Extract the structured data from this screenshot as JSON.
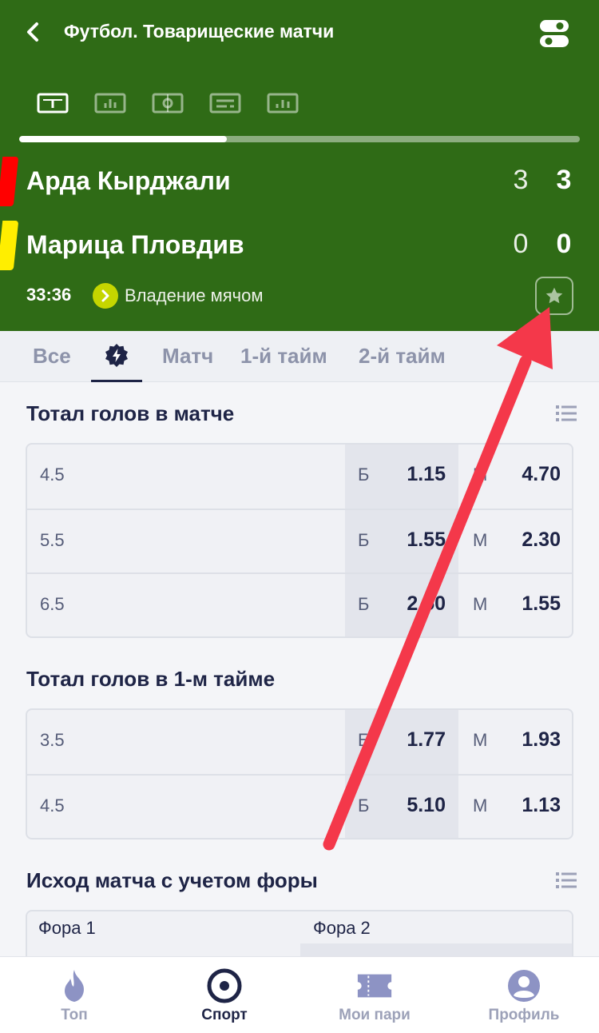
{
  "header": {
    "title": "Футбол. Товарищеские матчи",
    "back_icon": "chevron-left-icon",
    "toggle_icon": "toggle-icon",
    "icon_tabs": [
      "scoreboard-icon",
      "stats-icon",
      "field-icon",
      "lineup-icon",
      "chart-icon"
    ],
    "progress": 0.37,
    "colors": {
      "background": "#2f6b16",
      "card_red": "#ff0000",
      "card_yellow": "#ffee00"
    }
  },
  "match": {
    "team1": {
      "name": "Арда Кырджали",
      "score1": "3",
      "score2": "3"
    },
    "team2": {
      "name": "Марица Пловдив",
      "score1": "0",
      "score2": "0"
    },
    "time": "33:36",
    "status": "Владение мячом"
  },
  "filter_tabs": {
    "all": "Все",
    "match": "Матч",
    "half1": "1-й тайм",
    "half2": "2-й тайм"
  },
  "sections": {
    "total_match": {
      "title": "Тотал голов в матче",
      "rows": [
        {
          "line": "4.5",
          "tag_b": "Б",
          "odd_b": "1.15",
          "tag_m": "М",
          "odd_m": "4.70"
        },
        {
          "line": "5.5",
          "tag_b": "Б",
          "odd_b": "1.55",
          "tag_m": "М",
          "odd_m": "2.30"
        },
        {
          "line": "6.5",
          "tag_b": "Б",
          "odd_b": "2.50",
          "tag_m": "М",
          "odd_m": "1.55"
        }
      ]
    },
    "total_half1": {
      "title": "Тотал голов в 1-м тайме",
      "rows": [
        {
          "line": "3.5",
          "tag_b": "Б",
          "odd_b": "1.77",
          "tag_m": "М",
          "odd_m": "1.93"
        },
        {
          "line": "4.5",
          "tag_b": "Б",
          "odd_b": "5.10",
          "tag_m": "М",
          "odd_m": "1.13"
        }
      ]
    },
    "handicap": {
      "title": "Исход матча с учетом форы",
      "col1": "Фора 1",
      "col2": "Фора 2"
    }
  },
  "bottom_nav": {
    "top": "Топ",
    "sport": "Спорт",
    "my_bets": "Мои пари",
    "profile": "Профиль"
  },
  "annotation": {
    "arrow_color": "#f4384a"
  }
}
